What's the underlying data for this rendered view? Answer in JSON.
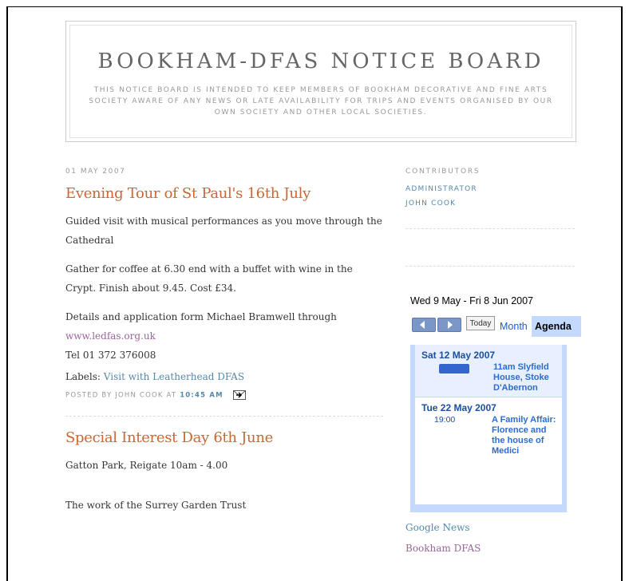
{
  "header": {
    "title": "BOOKHAM-DFAS NOTICE BOARD",
    "description": "THIS NOTICE BOARD IS INTENDED TO KEEP MEMBERS OF BOOKHAM DECORATIVE AND FINE ARTS SOCIETY AWARE OF ANY NEWS OR LATE AVAILABILITY FOR TRIPS AND EVENTS ORGANISED BY OUR OWN SOCIETY AND OTHER LOCAL SOCIETIES."
  },
  "posts": [
    {
      "date": "01 MAY 2007",
      "title": "Evening Tour of St Paul's 16th July",
      "p1": "Guided visit with musical performances as you move through the Cathedral",
      "p2": "Gather for coffee at 6.30 end with a buffet with wine in the Crypt. Finish about 9.45. Cost £34.",
      "p3_text": "Details and application form Michael Bramwell through",
      "p3_link": "www.ledfas.org.uk",
      "p3_tel": "Tel 01 372 376008",
      "labels_prefix": "Labels:",
      "labels_link": "Visit with Leatherhead DFAS",
      "posted_by": "POSTED BY JOHN COOK AT",
      "posted_time": "10:45 AM"
    },
    {
      "title": "Special Interest Day 6th June",
      "p1": "Gatton Park, Reigate 10am - 4.00",
      "p2": "The work of the Surrey Garden Trust"
    }
  ],
  "sidebar": {
    "contributors_heading": "CONTRIBUTORS",
    "contributors": [
      "ADMINISTRATOR",
      "JOHN COOK"
    ],
    "links": [
      "Google News",
      "Bookham DFAS"
    ]
  },
  "calendar": {
    "range": "Wed 9 May - Fri 8 Jun 2007",
    "today_label": "Today",
    "month_tab": "Month",
    "agenda_tab": "Agenda",
    "days": [
      {
        "label": "Sat 12 May 2007",
        "event_title": "11am Slyfield House, Stoke D'Abernon"
      },
      {
        "label": "Tue 22 May 2007",
        "event_time": "19:00",
        "event_title": "A Family Affair: Florence and the house of Medici"
      }
    ],
    "colors": {
      "toolbar": "#7a97c7",
      "agenda_bg": "#c3d9ff",
      "event": "#3366cc"
    }
  }
}
